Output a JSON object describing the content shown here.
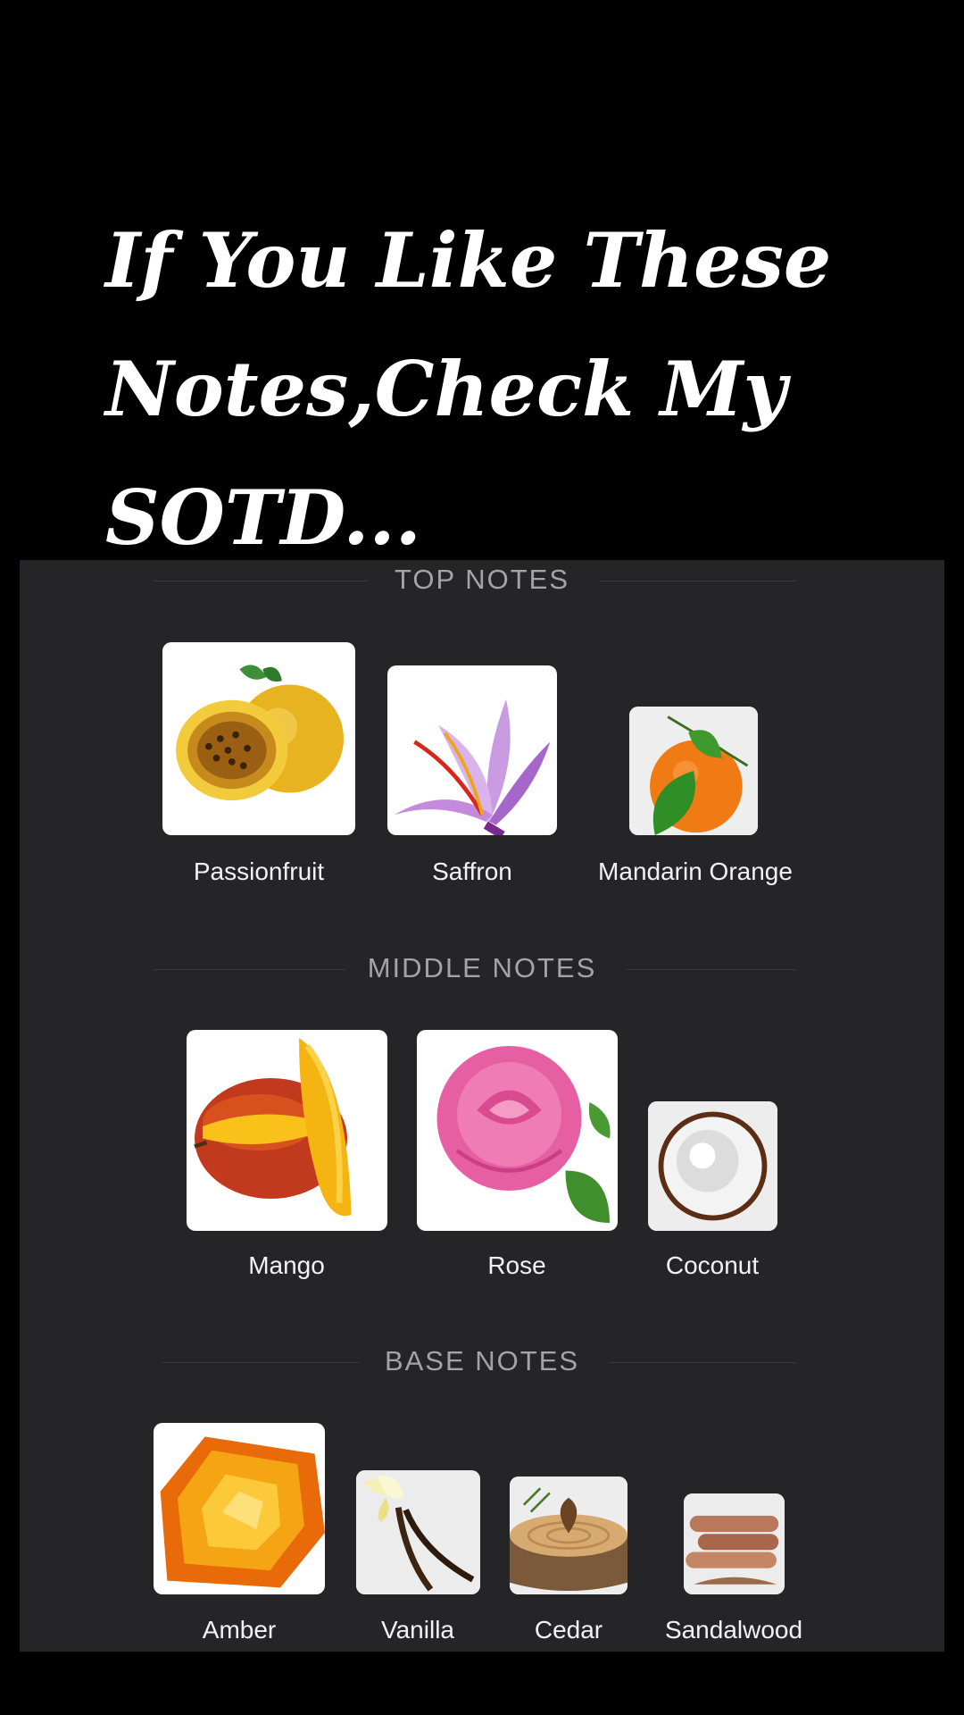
{
  "caption": {
    "line1": "If You Like These",
    "line2": "Notes,Check My",
    "line3": "SOTD..."
  },
  "top_notes": {
    "title": "TOP NOTES",
    "items": [
      {
        "label": "Passionfruit",
        "icon": "passionfruit-icon"
      },
      {
        "label": "Saffron",
        "icon": "saffron-flower-icon"
      },
      {
        "label": "Mandarin Orange",
        "icon": "mandarin-orange-icon"
      }
    ]
  },
  "middle_notes": {
    "title": "MIDDLE NOTES",
    "items": [
      {
        "label": "Mango",
        "icon": "mango-icon"
      },
      {
        "label": "Rose",
        "icon": "rose-icon"
      },
      {
        "label": "Coconut",
        "icon": "coconut-icon"
      }
    ]
  },
  "base_notes": {
    "title": "BASE NOTES",
    "items": [
      {
        "label": "Amber",
        "icon": "amber-icon"
      },
      {
        "label": "Vanilla",
        "icon": "vanilla-icon"
      },
      {
        "label": "Cedar",
        "icon": "cedar-icon"
      },
      {
        "label": "Sandalwood",
        "icon": "sandalwood-icon"
      }
    ]
  },
  "colors": {
    "page_background": "#000000",
    "panel_background": "#252528",
    "section_title": "#a3a3a8",
    "label_text": "#f2f2f2"
  }
}
